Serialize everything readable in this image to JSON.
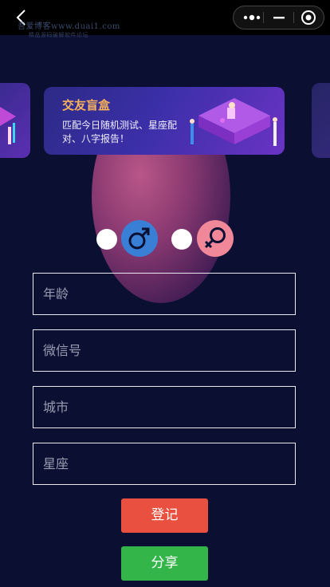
{
  "watermark": {
    "line1": "吾爱博客www.duai1.com",
    "line2": "精品源码破解软件论坛"
  },
  "banner": {
    "title": "交友盲盒",
    "description": "匹配今日随机测试、星座配对、八字报告！"
  },
  "gender": {
    "options": [
      "male",
      "female"
    ],
    "colors": {
      "male": "#3a7fd6",
      "female": "#f0889a"
    }
  },
  "form": {
    "age_placeholder": "年龄",
    "wechat_placeholder": "微信号",
    "city_placeholder": "城市",
    "constellation_placeholder": "星座"
  },
  "buttons": {
    "register": "登记",
    "share": "分享"
  },
  "colors": {
    "background": "#0b1033",
    "register": "#e9503f",
    "share": "#33b54a",
    "banner_title": "#f6b15a"
  }
}
